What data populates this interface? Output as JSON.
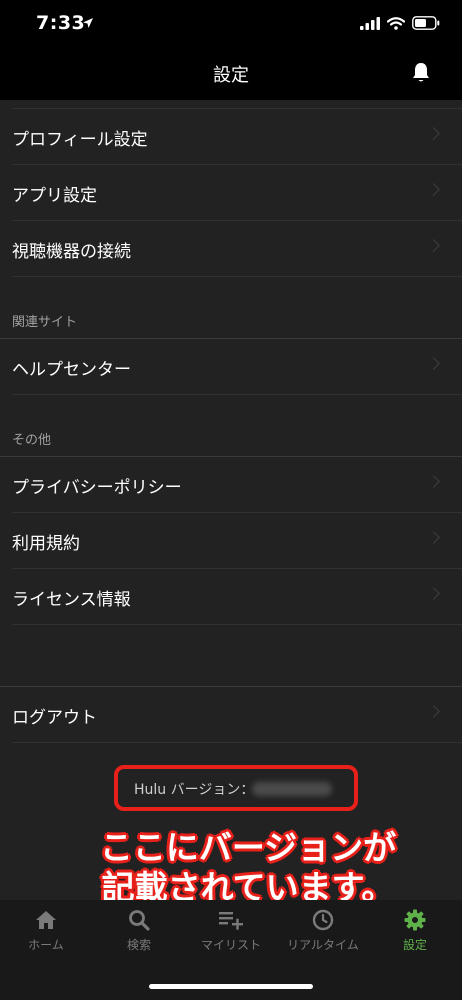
{
  "status_bar": {
    "time": "7:33"
  },
  "header": {
    "title": "設定"
  },
  "menu": {
    "profile": "プロフィール設定",
    "app_settings": "アプリ設定",
    "device_connect": "視聴機器の接続",
    "section_related": "関連サイト",
    "help_center": "ヘルプセンター",
    "section_other": "その他",
    "privacy_policy": "プライバシーポリシー",
    "terms": "利用規約",
    "license": "ライセンス情報",
    "logout": "ログアウト"
  },
  "version": {
    "label": "Hulu バージョン："
  },
  "annotation": {
    "line1": "ここにバージョンが",
    "line2": "記載されています。",
    "color": "#e8201a"
  },
  "tabs": [
    {
      "label": "ホーム",
      "icon": "home-icon"
    },
    {
      "label": "検索",
      "icon": "search-icon"
    },
    {
      "label": "マイリスト",
      "icon": "playlist-add-icon"
    },
    {
      "label": "リアルタイム",
      "icon": "clock-icon"
    },
    {
      "label": "設定",
      "icon": "gear-icon",
      "active": true
    }
  ],
  "colors": {
    "background": "#222222",
    "bars": "#000000",
    "tab_bar": "#191919",
    "accent": "#5fb14a"
  }
}
